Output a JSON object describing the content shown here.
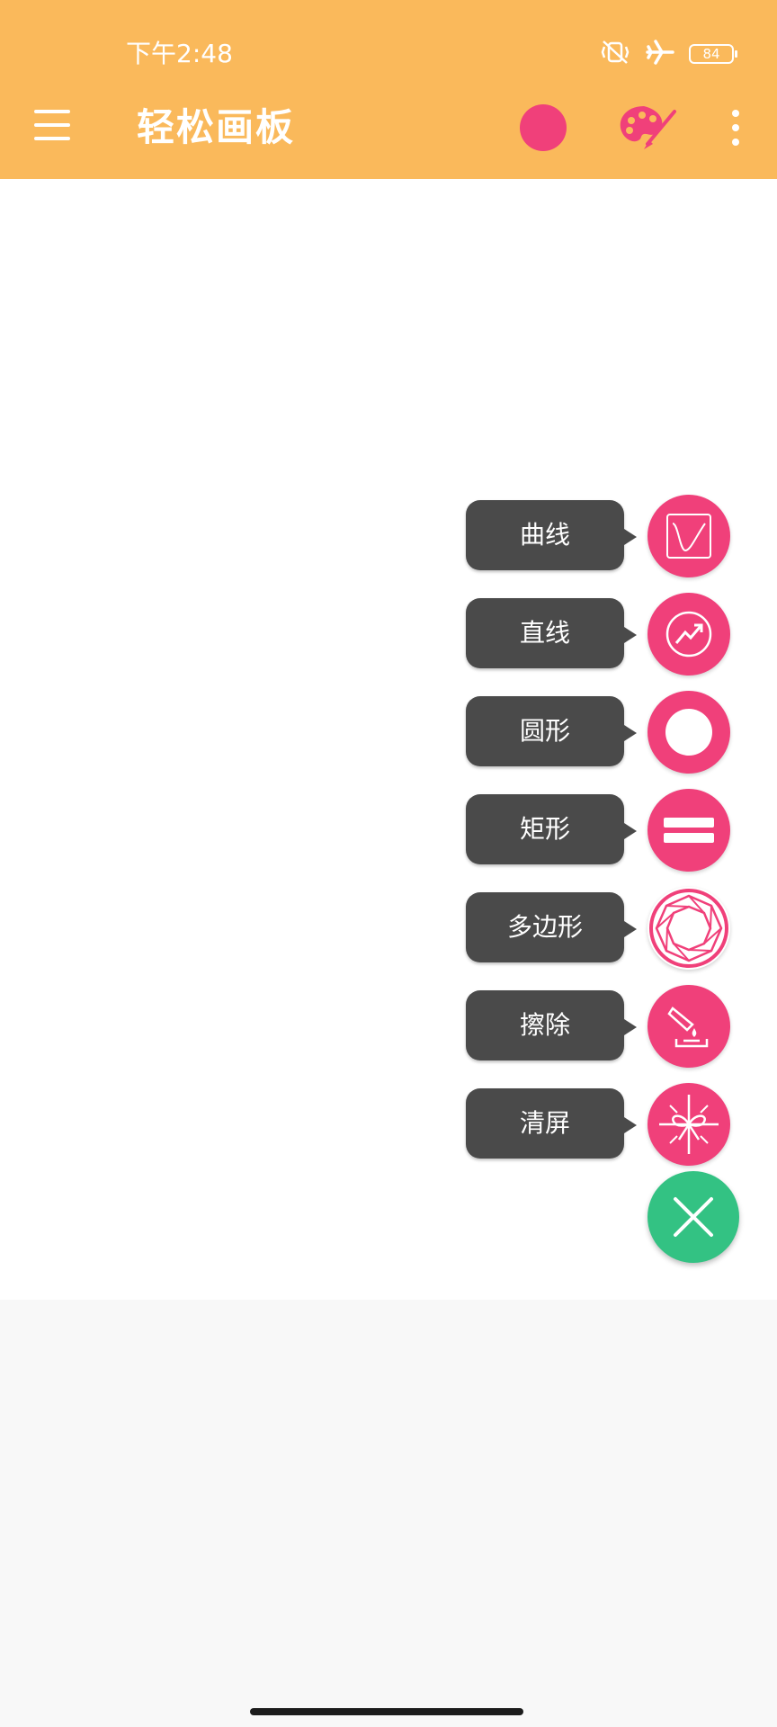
{
  "status_bar": {
    "time": "下午2:48",
    "battery": "84",
    "icons": [
      "mute-vibrate-icon",
      "airplane-icon",
      "battery-icon"
    ]
  },
  "toolbar": {
    "title": "轻松画板",
    "menu_icon": "hamburger-menu-icon",
    "color_swatch": "#f0407a",
    "palette_icon": "palette-icon",
    "overflow_icon": "more-vert-icon"
  },
  "colors": {
    "header": "#fab95b",
    "accent": "#f0407a",
    "fab_close": "#33c283",
    "label_bg": "#4a4a4a"
  },
  "fab_menu": {
    "items": [
      {
        "label": "曲线",
        "icon": "curve-icon"
      },
      {
        "label": "直线",
        "icon": "line-icon"
      },
      {
        "label": "圆形",
        "icon": "circle-icon"
      },
      {
        "label": "矩形",
        "icon": "rectangle-icon"
      },
      {
        "label": "多边形",
        "icon": "polygon-icon"
      },
      {
        "label": "擦除",
        "icon": "eraser-icon"
      },
      {
        "label": "清屏",
        "icon": "clear-screen-icon"
      }
    ],
    "close_icon": "close-icon"
  }
}
